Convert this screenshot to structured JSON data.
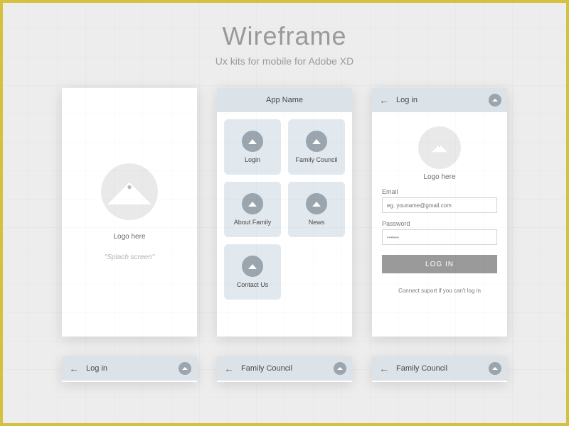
{
  "header": {
    "title": "Wireframe",
    "subtitle": "Ux kits for mobile for Adobe XD"
  },
  "splash": {
    "logo_label": "Logo here",
    "caption": "\"Splach screen\""
  },
  "home": {
    "appbar_title": "App Name",
    "tiles": [
      {
        "label": "Login"
      },
      {
        "label": "Family Council"
      },
      {
        "label": "About Family"
      },
      {
        "label": "News"
      },
      {
        "label": "Contact Us"
      }
    ]
  },
  "login": {
    "appbar_title": "Log in",
    "logo_label": "Logo here",
    "email_label": "Email",
    "email_placeholder": "eg. youname@gmail.com",
    "password_label": "Password",
    "password_value": "••••••",
    "button_label": "LOG IN",
    "support_text": "Connect suport if you can't log in"
  },
  "bottom": {
    "b1": "Log in",
    "b2": "Family Council",
    "b3": "Family Council"
  }
}
